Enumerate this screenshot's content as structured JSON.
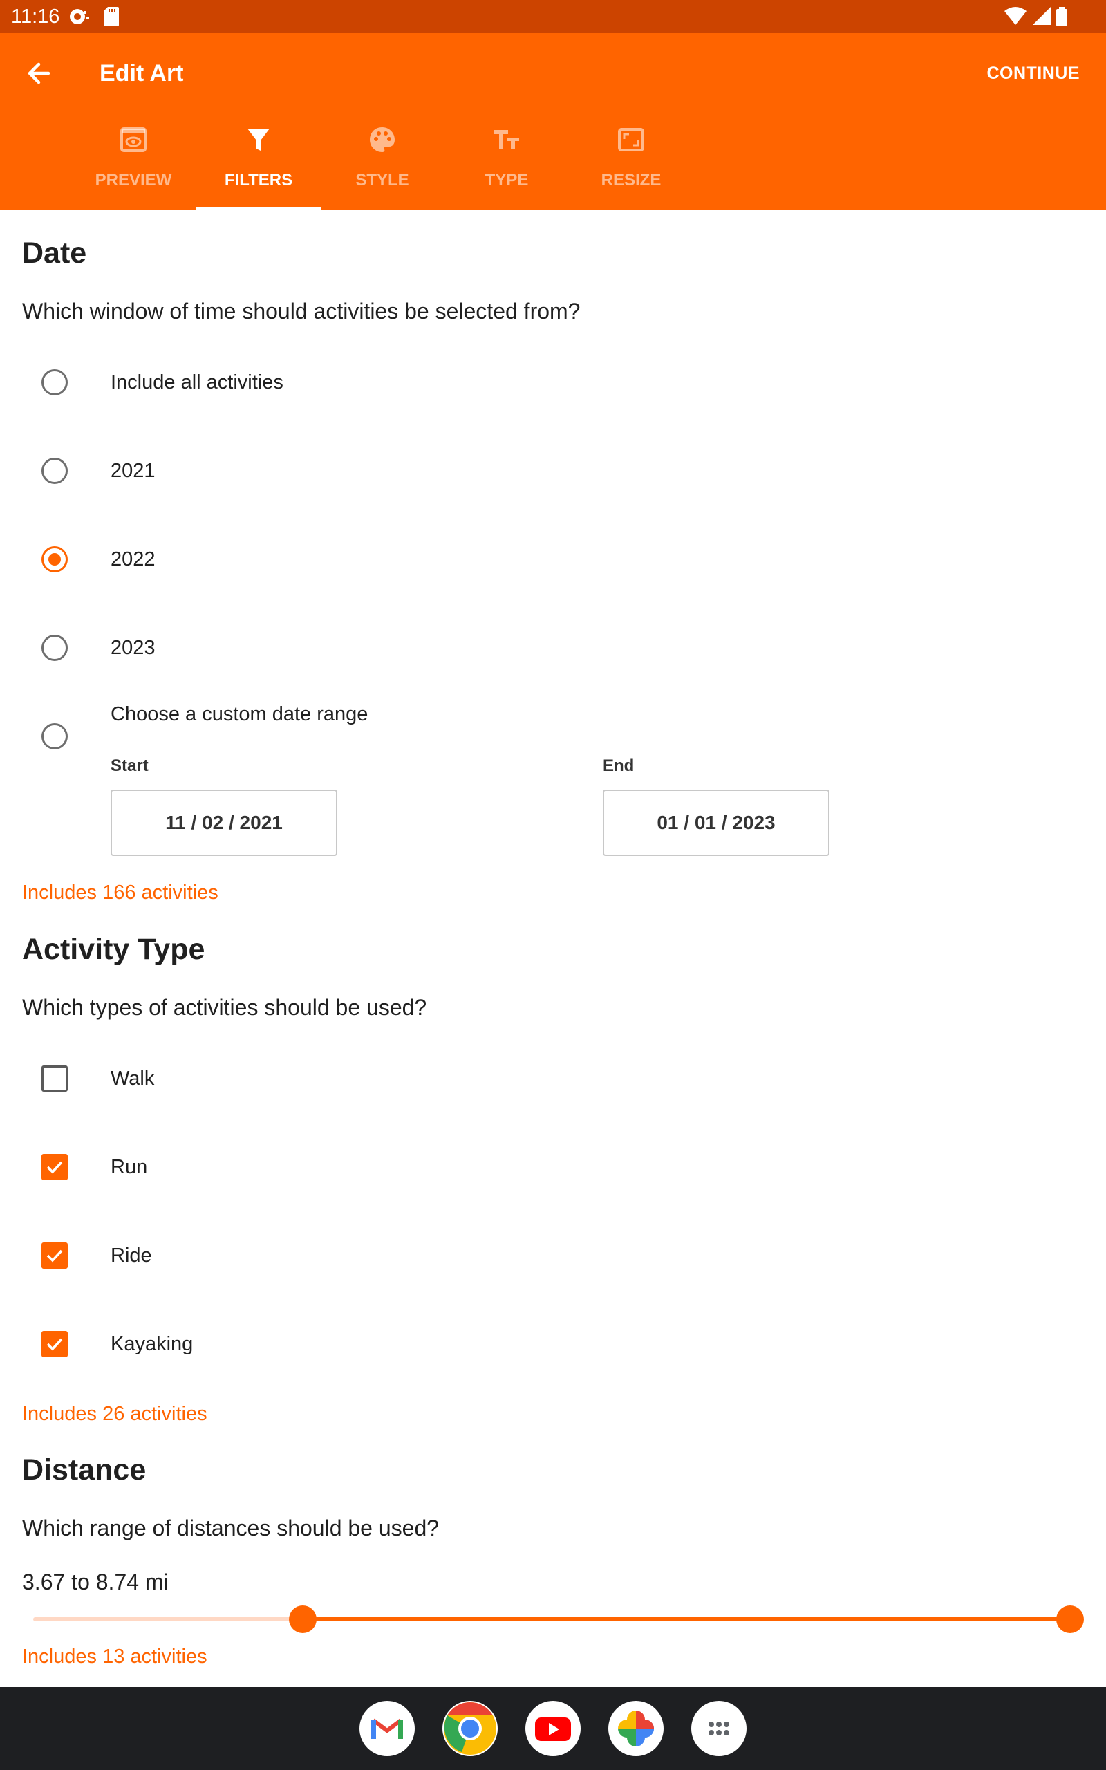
{
  "status_bar": {
    "time": "11:16"
  },
  "app_bar": {
    "title": "Edit Art",
    "continue_label": "CONTINUE"
  },
  "tabs": [
    {
      "label": "PREVIEW",
      "icon": "preview-icon",
      "active": false
    },
    {
      "label": "FILTERS",
      "icon": "filter-icon",
      "active": true
    },
    {
      "label": "STYLE",
      "icon": "palette-icon",
      "active": false
    },
    {
      "label": "TYPE",
      "icon": "text-type-icon",
      "active": false
    },
    {
      "label": "RESIZE",
      "icon": "resize-icon",
      "active": false
    }
  ],
  "date": {
    "title": "Date",
    "question": "Which window of time should activities be selected from?",
    "options": [
      {
        "label": "Include all activities",
        "selected": false
      },
      {
        "label": "2021",
        "selected": false
      },
      {
        "label": "2022",
        "selected": true
      },
      {
        "label": "2023",
        "selected": false
      },
      {
        "label": "Choose a custom date range",
        "selected": false
      }
    ],
    "start_label": "Start",
    "start_value": "11 / 02 / 2021",
    "end_label": "End",
    "end_value": "01 / 01 / 2023",
    "includes": "Includes 166 activities"
  },
  "activity_type": {
    "title": "Activity Type",
    "question": "Which types of activities should be used?",
    "options": [
      {
        "label": "Walk",
        "checked": false
      },
      {
        "label": "Run",
        "checked": true
      },
      {
        "label": "Ride",
        "checked": true
      },
      {
        "label": "Kayaking",
        "checked": true
      }
    ],
    "includes": "Includes 26 activities"
  },
  "distance": {
    "title": "Distance",
    "question": "Which range of distances should be used?",
    "range_text": "3.67 to 8.74 mi",
    "slider_low_fraction": 0.26,
    "slider_high_fraction": 1.0,
    "includes": "Includes 13 activities"
  },
  "dock": {
    "apps": [
      "gmail-icon",
      "chrome-icon",
      "youtube-icon",
      "photos-icon",
      "app-drawer-icon"
    ]
  },
  "colors": {
    "accent": "#ff6400",
    "status_bar": "#cc4400",
    "dock": "#1e1f22"
  }
}
